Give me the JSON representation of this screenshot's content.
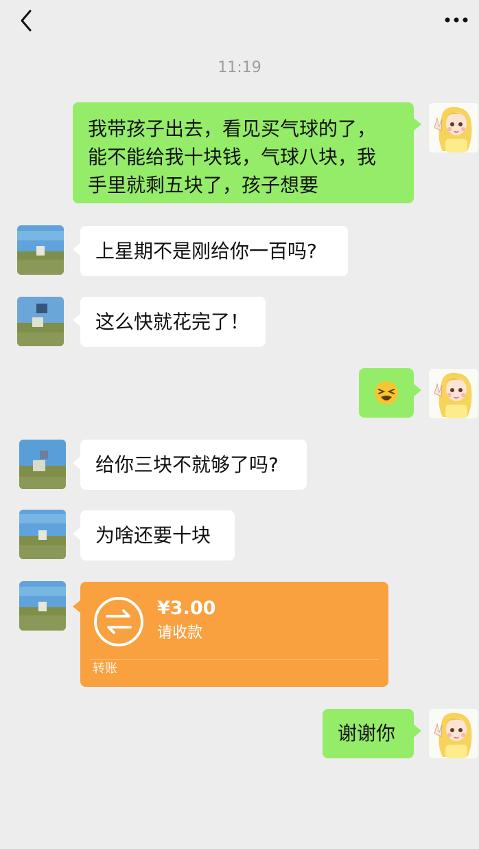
{
  "header": {
    "back_icon": "chevron-left-icon",
    "more_icon": "more-dots-icon"
  },
  "chat": {
    "timestamp": "11:19",
    "messages": [
      {
        "sender": "me",
        "lines": [
          "我带孩子出去，看见买气球的了，",
          "能不能给我十块钱，气球八块，我",
          "手里就剩五块了，孩子想要"
        ]
      },
      {
        "sender": "other",
        "text": "上星期不是刚给你一百吗?"
      },
      {
        "sender": "other",
        "text": "这么快就花完了！"
      },
      {
        "sender": "me",
        "emoji": "crying-laughing-emoji",
        "emoji_char": "😆"
      },
      {
        "sender": "other",
        "text": "给你三块不就够了吗?"
      },
      {
        "sender": "other",
        "text": "为啥还要十块"
      },
      {
        "sender": "other",
        "type": "transfer",
        "amount": "¥3.00",
        "status": "请收款",
        "label": "转账"
      },
      {
        "sender": "me",
        "text": "谢谢你"
      }
    ]
  },
  "colors": {
    "background": "#ededed",
    "my_bubble": "#95ec69",
    "other_bubble": "#ffffff",
    "transfer": "#f9a03f"
  }
}
